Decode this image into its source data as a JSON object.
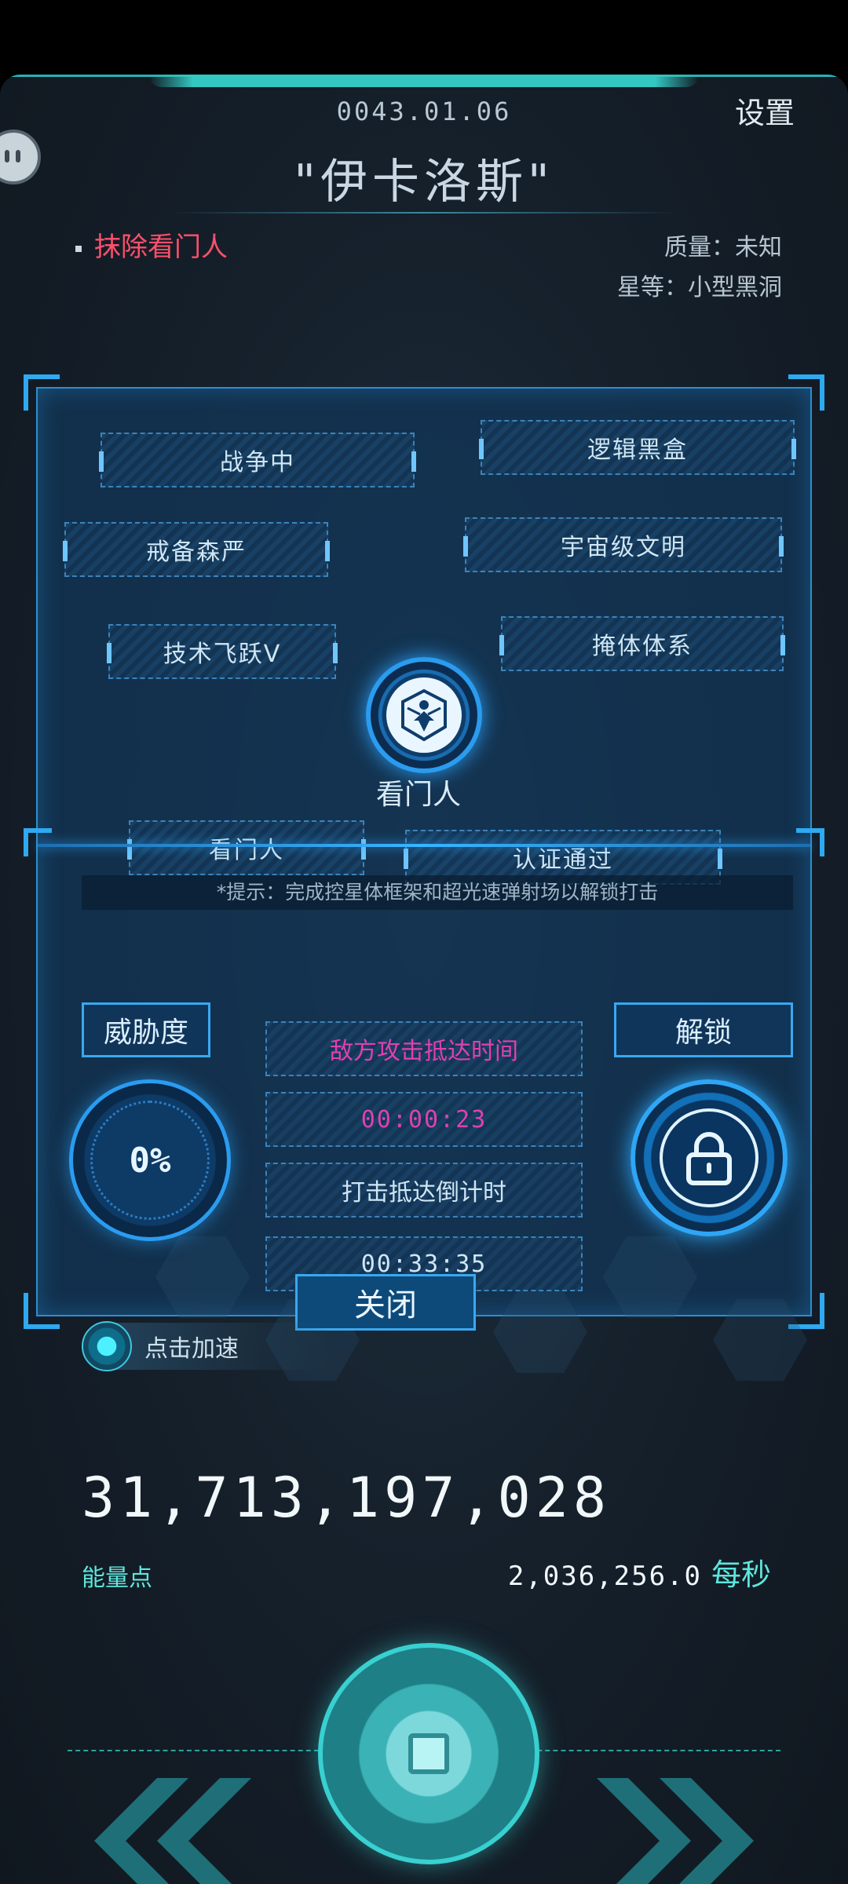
{
  "header": {
    "date": "0043.01.06",
    "settings_label": "设置",
    "title": "\"伊卡洛斯\""
  },
  "target": {
    "mission": "抹除看门人",
    "quality": "质量：未知",
    "grade": "星等：小型黑洞"
  },
  "tags": [
    "战争中",
    "逻辑黑盒",
    "戒备森严",
    "宇宙级文明",
    "技术飞跃V",
    "掩体体系",
    "看门人",
    "认证通过"
  ],
  "central_label": "看门人",
  "hint": "*提示：完成控星体框架和超光速弹射场以解锁打击",
  "threat": {
    "label": "威胁度",
    "value": "0%"
  },
  "unlock_label": "解锁",
  "timers": {
    "enemy_label": "敌方攻击抵达时间",
    "enemy_time": "00:00:23",
    "strike_label": "打击抵达倒计时",
    "strike_time": "00:33:35"
  },
  "close_label": "关闭",
  "speed_label": "点击加速",
  "energy": {
    "value": "31,713,197,028",
    "label": "能量点",
    "rate": "2,036,256.0",
    "rate_unit": "每秒"
  },
  "colors": {
    "accent_cyan": "#38d0d0",
    "panel_blue": "#2d8ed0",
    "mission_red": "#ff4f6b",
    "timer_magenta": "#e040b0"
  }
}
